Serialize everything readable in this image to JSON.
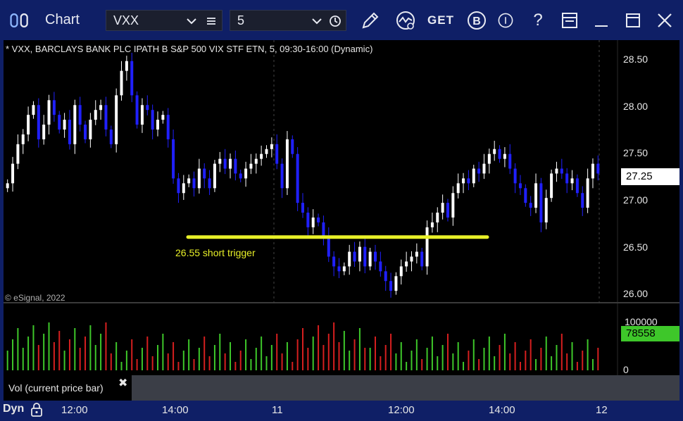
{
  "window": {
    "title": "Chart",
    "symbol": "VXX",
    "interval": "5"
  },
  "toolbar": {
    "icons": [
      "pencil-icon",
      "study-icon",
      "get-icon",
      "bars-icon",
      "timer-icon",
      "help-icon",
      "page-icon",
      "minimize-icon",
      "maximize-icon",
      "close-icon"
    ],
    "get_label": "GET",
    "b_label": "B",
    "help_label": "?"
  },
  "chart": {
    "title": "* VXX, BARCLAYS BANK PLC IPATH B S&P 500 VIX STF ETN, 5, 09:30-16:00 (Dynamic)",
    "copyright": "© eSignal, 2022",
    "annotation": "26.55 short trigger",
    "current_price": "27.25",
    "price_axis": [
      "28.50",
      "28.00",
      "27.50",
      "27.00",
      "26.50",
      "26.00"
    ],
    "volume_panel_label": "Vol (current price bar)",
    "volume_axis_top": "100000",
    "volume_axis_zero": "0",
    "current_volume": "78558",
    "x_axis": [
      "12:00",
      "14:00",
      "11",
      "12:00",
      "14:00",
      "12"
    ],
    "x_axis_mode": "Dyn",
    "colors": {
      "up": "#ffffff",
      "down": "#2020ff",
      "trigger": "#e8f028",
      "vol_up": "#3ec72a",
      "vol_down": "#d61f1f"
    }
  },
  "chart_data": {
    "type": "candlestick",
    "title": "* VXX, BARCLAYS BANK PLC IPATH B S&P 500 VIX STF ETN, 5, 09:30-16:00 (Dynamic)",
    "ylim": [
      25.95,
      28.6
    ],
    "trigger_level": 26.6,
    "closes": [
      27.15,
      27.35,
      27.55,
      27.65,
      27.85,
      27.95,
      27.6,
      27.75,
      28.0,
      27.85,
      27.7,
      27.8,
      27.55,
      27.95,
      27.75,
      27.6,
      27.8,
      27.9,
      27.95,
      27.7,
      27.55,
      28.05,
      28.3,
      28.4,
      28.05,
      27.75,
      27.95,
      27.9,
      27.7,
      27.8,
      27.85,
      27.6,
      27.2,
      27.05,
      27.15,
      27.2,
      27.1,
      27.3,
      27.2,
      27.1,
      27.35,
      27.4,
      27.3,
      27.4,
      27.25,
      27.2,
      27.3,
      27.35,
      27.4,
      27.45,
      27.5,
      27.55,
      27.35,
      27.1,
      27.6,
      27.45,
      26.95,
      26.85,
      26.7,
      26.8,
      26.75,
      26.6,
      26.4,
      26.3,
      26.25,
      26.3,
      26.45,
      26.35,
      26.5,
      26.3,
      26.45,
      26.35,
      26.25,
      26.15,
      26.05,
      26.2,
      26.3,
      26.35,
      26.4,
      26.45,
      26.3,
      26.7,
      26.75,
      26.85,
      26.95,
      26.8,
      27.05,
      27.15,
      27.2,
      27.15,
      27.3,
      27.25,
      27.35,
      27.45,
      27.5,
      27.4,
      27.45,
      27.3,
      27.15,
      27.1,
      26.95,
      26.9,
      27.15,
      26.75,
      27.0,
      27.25,
      27.3,
      27.25,
      27.15,
      27.2,
      27.05,
      26.9,
      27.2,
      27.35,
      27.25
    ]
  }
}
